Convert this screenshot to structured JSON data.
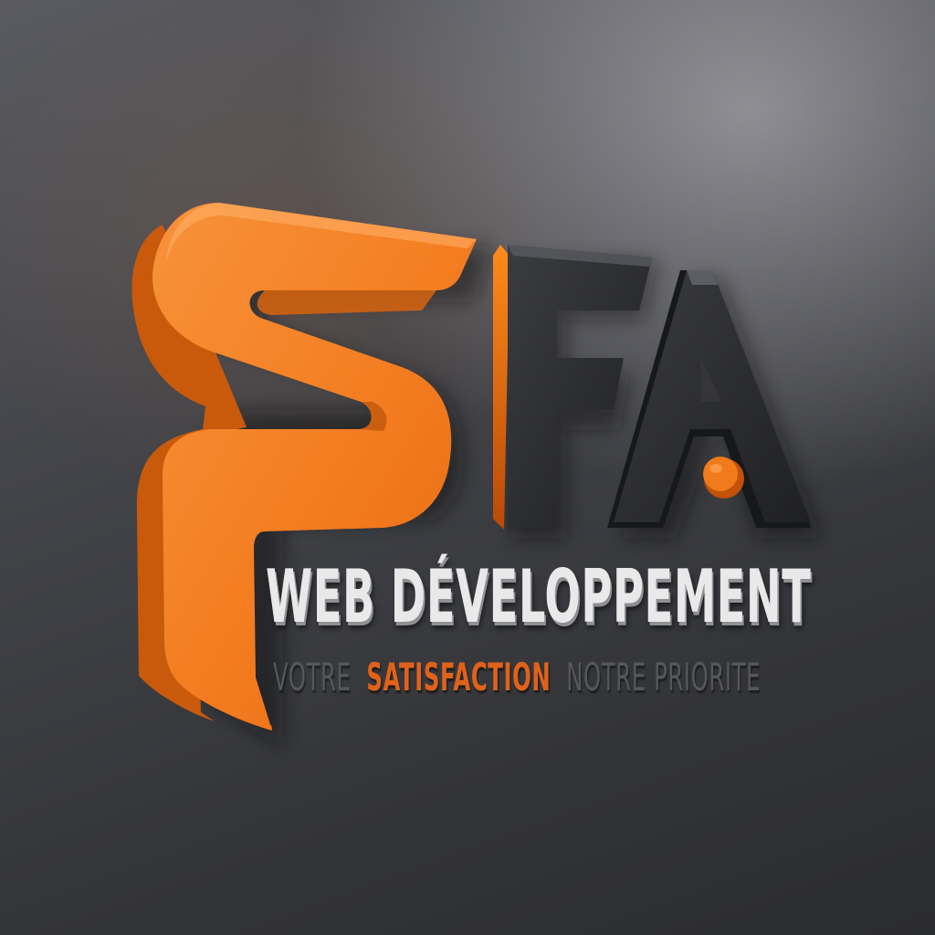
{
  "logo": {
    "letters": [
      "S",
      "F",
      "A"
    ],
    "accent_color": "#f07a1c",
    "dark_color": "#2c2d30"
  },
  "headline": "WEB DÉVELOPPEMENT",
  "tagline": {
    "part1": "VOTRE",
    "highlight": "SATISFACTION",
    "part2": "NOTRE PRIORITE"
  },
  "colors": {
    "headline": "#e9e9ea",
    "tagline_muted": "#55575c",
    "tagline_accent": "#e0621a"
  }
}
